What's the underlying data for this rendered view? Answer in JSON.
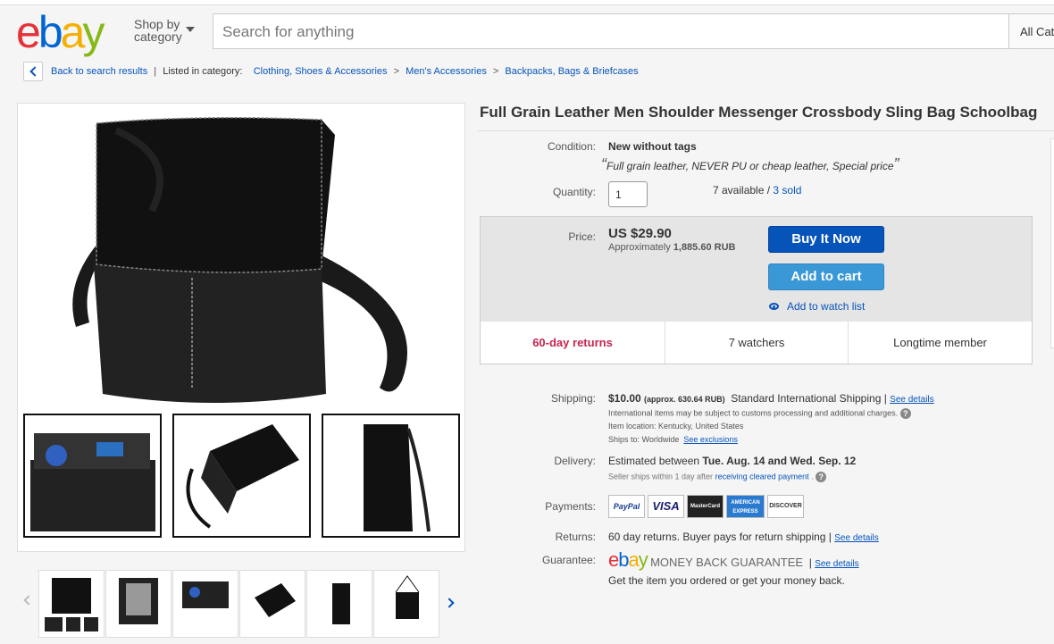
{
  "header": {
    "logo": {
      "e": "e",
      "b": "b",
      "a": "a",
      "y": "y"
    },
    "shop_by_line1": "Shop by",
    "shop_by_line2": "category",
    "search_placeholder": "Search for anything",
    "all_categories": "All Cate"
  },
  "breadcrumb": {
    "back": "Back to search results",
    "listed_in": "Listed in category:",
    "items": [
      "Clothing, Shoes & Accessories",
      "Men's Accessories",
      "Backpacks, Bags & Briefcases"
    ]
  },
  "item": {
    "title": "Full Grain Leather Men Shoulder Messenger Crossbody Sling Bag Schoolbag",
    "condition_label": "Condition:",
    "condition_value": "New without tags",
    "condition_note": "Full grain leather, NEVER PU or cheap leather, Special price",
    "quantity_label": "Quantity:",
    "quantity_value": "1",
    "available": "7 available",
    "sold": "3 sold",
    "price_label": "Price:",
    "price": "US $29.90",
    "approx_prefix": "Approximately",
    "approx_value": "1,885.60 RUB",
    "buy_now": "Buy It Now",
    "add_to_cart": "Add to cart",
    "watch_list": "Add to watch list",
    "returns_badge": "60-day returns",
    "watchers": "7 watchers",
    "member": "Longtime member"
  },
  "shipping": {
    "label": "Shipping:",
    "cost": "$10.00",
    "approx": "(approx. 630.64 RUB)",
    "service": "Standard International Shipping |",
    "see_details": "See details",
    "customs_note": "International items may be subject to customs processing and additional charges.",
    "location": "Item location:  Kentucky, United States",
    "ships_to": "Ships to:  Worldwide",
    "see_exclusions": "See exclusions"
  },
  "delivery": {
    "label": "Delivery:",
    "prefix": "Estimated between",
    "dates": "Tue. Aug. 14 and Wed. Sep. 12",
    "note_prefix": "Seller ships within 1 day after",
    "note_link": "receiving cleared payment",
    "note_suffix": "."
  },
  "payments": {
    "label": "Payments:",
    "cards": [
      "PayPal",
      "VISA",
      "MasterCard",
      "AMERICAN EXPRESS",
      "DISCOVER"
    ]
  },
  "returns": {
    "label": "Returns:",
    "text": "60 day returns. Buyer pays for return shipping |",
    "see_details": "See details"
  },
  "guarantee": {
    "label": "Guarantee:",
    "brand": "MONEY BACK GUARANTEE",
    "see_details": "See details",
    "text": "Get the item you ordered or get your money back."
  },
  "colors": {
    "ebay_red": "#e53238",
    "ebay_blue": "#0654ba",
    "ebay_yellow": "#f5af02",
    "ebay_green": "#86b817",
    "returns_red": "#c7254e"
  }
}
